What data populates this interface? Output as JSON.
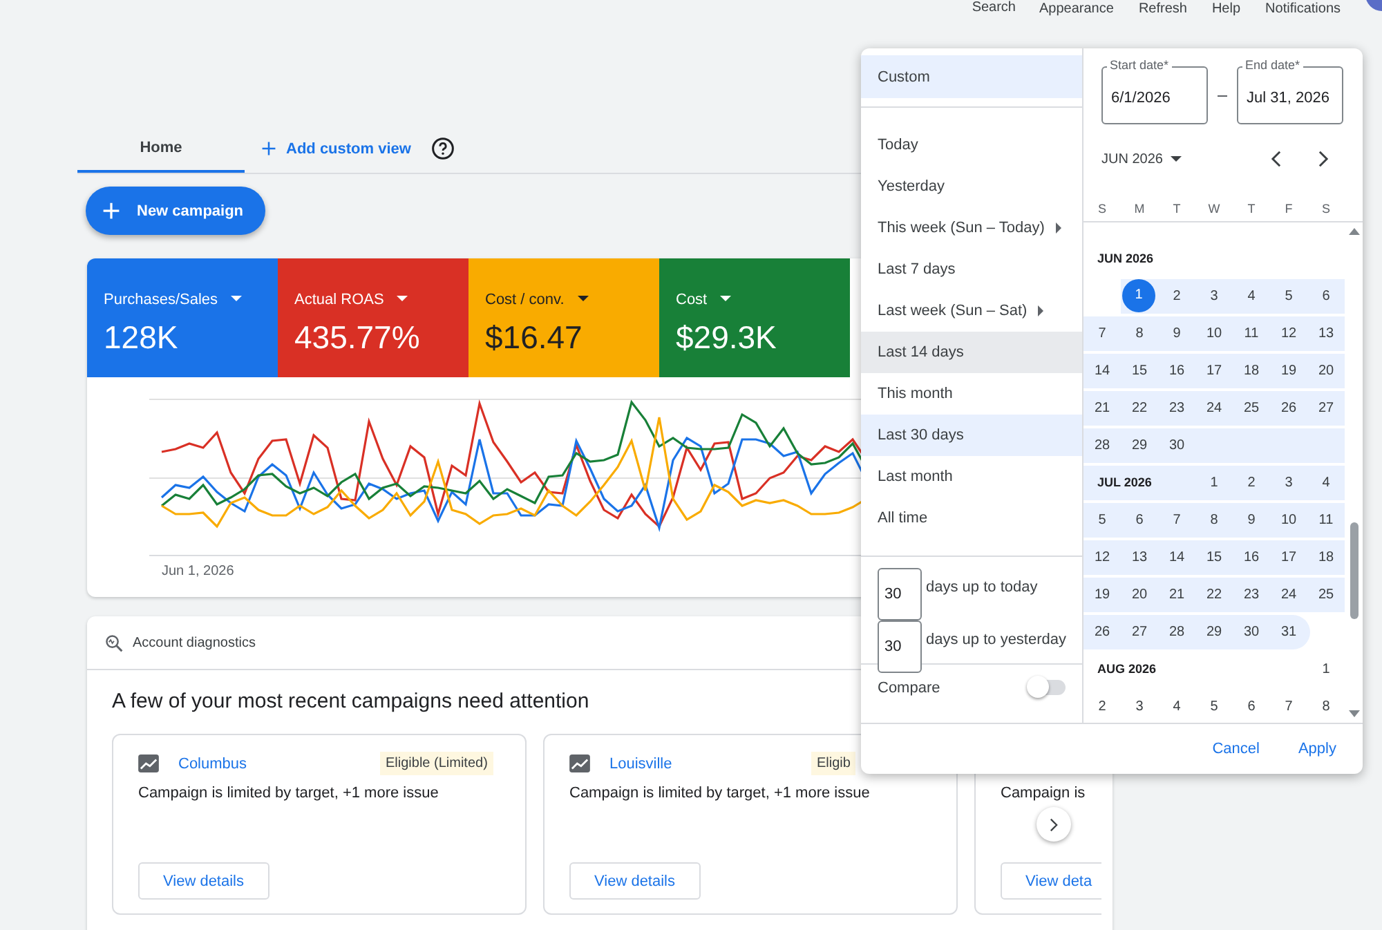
{
  "top_bar": {
    "items": [
      "Search",
      "Appearance",
      "Refresh",
      "Help",
      "Notifications"
    ]
  },
  "tabs": [
    {
      "label": "Home",
      "selected": true
    }
  ],
  "add_view": "Add custom view",
  "new_campaign": "New campaign",
  "metrics": [
    {
      "label": "Purchases/Sales",
      "value": "128K",
      "color": "#1a73e8"
    },
    {
      "label": "Actual ROAS",
      "value": "435.77%",
      "color": "#d93025"
    },
    {
      "label": "Cost / conv.",
      "value": "$16.47",
      "color": "#f9ab00"
    },
    {
      "label": "Cost",
      "value": "$29.3K",
      "color": "#188038"
    }
  ],
  "chart": {
    "x_label": "Jun 1, 2026"
  },
  "diagnostics": {
    "title": "Account diagnostics",
    "heading": "A few of your most recent campaigns need attention",
    "campaigns": [
      {
        "name": "Columbus",
        "badge": "Eligible (Limited)",
        "issue": "Campaign is limited by target, +1 more issue",
        "button": "View details"
      },
      {
        "name": "Louisville",
        "badge": "Eligib",
        "issue": "Campaign is limited by target, +1 more issue",
        "button": "View details"
      },
      {
        "issue": "Campaign is",
        "button": "View deta"
      }
    ]
  },
  "date_picker": {
    "custom": {
      "label": "Custom",
      "selected": true
    },
    "presets": [
      {
        "label": "Today",
        "selected": false,
        "highlighted": false,
        "submenu": false
      },
      {
        "label": "Yesterday",
        "selected": false,
        "highlighted": false,
        "submenu": false
      },
      {
        "label": "This week (Sun – Today)",
        "selected": false,
        "highlighted": false,
        "submenu": true
      },
      {
        "label": "Last 7 days",
        "selected": false,
        "highlighted": false,
        "submenu": false
      },
      {
        "label": "Last week (Sun – Sat)",
        "selected": false,
        "highlighted": false,
        "submenu": true
      },
      {
        "label": "Last 14 days",
        "selected": false,
        "highlighted": true,
        "submenu": false
      },
      {
        "label": "This month",
        "selected": false,
        "highlighted": false,
        "submenu": false
      },
      {
        "label": "Last 30 days",
        "selected": true,
        "highlighted": false,
        "submenu": false
      },
      {
        "label": "Last month",
        "selected": false,
        "highlighted": false,
        "submenu": false
      },
      {
        "label": "All time",
        "selected": false,
        "highlighted": false,
        "submenu": false
      }
    ],
    "day_counts": [
      {
        "value": "30",
        "label": "days up to today"
      },
      {
        "value": "30",
        "label": "days up to yesterday"
      }
    ],
    "compare": {
      "label": "Compare",
      "on": false
    },
    "start_date": {
      "label": "Start date*",
      "value": "6/1/2026"
    },
    "end_date": {
      "label": "End date*",
      "value": "Jul 31, 2026"
    },
    "month_select": "JUN 2026",
    "weekdays": [
      "S",
      "M",
      "T",
      "W",
      "T",
      "F",
      "S"
    ],
    "months": [
      {
        "label": "JUN 2026",
        "weeks": [
          {
            "in_range": true,
            "days": [
              {
                "day": "1",
                "selected": true
              },
              {
                "day": "2",
                "selected": false
              },
              {
                "day": "3",
                "selected": false
              },
              {
                "day": "4",
                "selected": false
              },
              {
                "day": "5",
                "selected": false
              },
              {
                "day": "6",
                "selected": false
              }
            ]
          },
          {
            "in_range": true,
            "days": [
              {
                "day": "7",
                "selected": false
              },
              {
                "day": "8",
                "selected": false
              },
              {
                "day": "9",
                "selected": false
              },
              {
                "day": "10",
                "selected": false
              },
              {
                "day": "11",
                "selected": false
              },
              {
                "day": "12",
                "selected": false
              },
              {
                "day": "13",
                "selected": false
              }
            ]
          },
          {
            "in_range": true,
            "days": [
              {
                "day": "14",
                "selected": false
              },
              {
                "day": "15",
                "selected": false
              },
              {
                "day": "16",
                "selected": false
              },
              {
                "day": "17",
                "selected": false
              },
              {
                "day": "18",
                "selected": false
              },
              {
                "day": "19",
                "selected": false
              },
              {
                "day": "20",
                "selected": false
              }
            ]
          },
          {
            "in_range": true,
            "days": [
              {
                "day": "21",
                "selected": false
              },
              {
                "day": "22",
                "selected": false
              },
              {
                "day": "23",
                "selected": false
              },
              {
                "day": "24",
                "selected": false
              },
              {
                "day": "25",
                "selected": false
              },
              {
                "day": "26",
                "selected": false
              },
              {
                "day": "27",
                "selected": false
              }
            ]
          },
          {
            "in_range": true,
            "days": [
              {
                "day": "28",
                "selected": false
              },
              {
                "day": "29",
                "selected": false
              },
              {
                "day": "30",
                "selected": false
              }
            ]
          }
        ]
      },
      {
        "label": "JUL 2026",
        "weeks": [
          {
            "in_range": true,
            "days": [
              {
                "day": "1",
                "selected": false
              },
              {
                "day": "2",
                "selected": false
              },
              {
                "day": "3",
                "selected": false
              },
              {
                "day": "4",
                "selected": false
              }
            ]
          },
          {
            "in_range": true,
            "days": [
              {
                "day": "5",
                "selected": false
              },
              {
                "day": "6",
                "selected": false
              },
              {
                "day": "7",
                "selected": false
              },
              {
                "day": "8",
                "selected": false
              },
              {
                "day": "9",
                "selected": false
              },
              {
                "day": "10",
                "selected": false
              },
              {
                "day": "11",
                "selected": false
              }
            ]
          },
          {
            "in_range": true,
            "days": [
              {
                "day": "12",
                "selected": false
              },
              {
                "day": "13",
                "selected": false
              },
              {
                "day": "14",
                "selected": false
              },
              {
                "day": "15",
                "selected": false
              },
              {
                "day": "16",
                "selected": false
              },
              {
                "day": "17",
                "selected": false
              },
              {
                "day": "18",
                "selected": false
              }
            ]
          },
          {
            "in_range": true,
            "days": [
              {
                "day": "19",
                "selected": false
              },
              {
                "day": "20",
                "selected": false
              },
              {
                "day": "21",
                "selected": false
              },
              {
                "day": "22",
                "selected": false
              },
              {
                "day": "23",
                "selected": false
              },
              {
                "day": "24",
                "selected": false
              },
              {
                "day": "25",
                "selected": false
              }
            ]
          },
          {
            "in_range": true,
            "days": [
              {
                "day": "26",
                "selected": false
              },
              {
                "day": "27",
                "selected": false
              },
              {
                "day": "28",
                "selected": false
              },
              {
                "day": "29",
                "selected": false
              },
              {
                "day": "30",
                "selected": false
              },
              {
                "day": "31",
                "selected": false
              }
            ]
          }
        ]
      },
      {
        "label": "AUG 2026",
        "weeks": [
          {
            "in_range": false,
            "days": [
              {
                "day": "1",
                "selected": false
              }
            ]
          },
          {
            "in_range": false,
            "days": [
              {
                "day": "2",
                "selected": false
              },
              {
                "day": "3",
                "selected": false
              },
              {
                "day": "4",
                "selected": false
              },
              {
                "day": "5",
                "selected": false
              },
              {
                "day": "6",
                "selected": false
              },
              {
                "day": "7",
                "selected": false
              },
              {
                "day": "8",
                "selected": false
              }
            ]
          }
        ]
      }
    ],
    "cancel": "Cancel",
    "apply": "Apply"
  }
}
